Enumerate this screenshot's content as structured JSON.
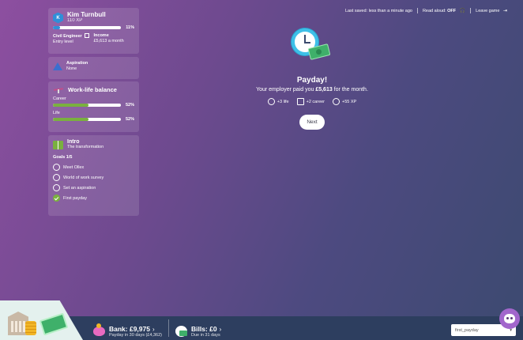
{
  "profile": {
    "initial": "K",
    "name": "Kim Turnbull",
    "xp": "110 XP",
    "xp_progress_pct": "11%",
    "xp_progress": 0.11,
    "job_title": "Civil Engineer",
    "job_level": "Entry level",
    "income_label": "Income",
    "income_value": "£5,613 a month"
  },
  "aspiration": {
    "label": "Aspiration",
    "value": "None"
  },
  "work_life": {
    "title": "Work-life balance",
    "career_label": "Career",
    "career_pct": "52%",
    "career_value": 0.52,
    "life_label": "Life",
    "life_pct": "52%",
    "life_value": 0.52,
    "bar_color": "#7ab03f"
  },
  "intro": {
    "title": "Intro",
    "subtitle": "The transformation",
    "goals_label": "Goals 1/5",
    "goals": [
      {
        "label": "Meet Ollex",
        "done": false
      },
      {
        "label": "World of work survey",
        "done": false
      },
      {
        "label": "Set an aspiration",
        "done": false
      },
      {
        "label": "First payday",
        "done": true
      }
    ]
  },
  "topbar": {
    "last_saved": "Last saved: less than a minute ago",
    "read_aloud_label": "Read aloud:",
    "read_aloud_value": "OFF",
    "leave_game": "Leave game"
  },
  "payday": {
    "title": "Payday!",
    "text_before": "Your employer paid you",
    "amount": "£5,613",
    "text_after": "for the month.",
    "rewards": [
      {
        "label": "+3 life",
        "icon": "smile-icon"
      },
      {
        "label": "+2 career",
        "icon": "briefcase-icon"
      },
      {
        "label": "+55 XP",
        "icon": "medal-icon"
      }
    ],
    "next_label": "Next"
  },
  "bottom": {
    "bank_label": "Bank: £9,975",
    "bank_sub": "Payday in 30 days (£4,362)",
    "bills_label": "Bills: £0",
    "bills_sub": "Due in 31 days",
    "debug_select_value": "first_payday"
  },
  "colors": {
    "xp_bar": "#2f8fd8",
    "accent_green": "#7ab03f",
    "bottom_bar": "#2d3e5f"
  }
}
